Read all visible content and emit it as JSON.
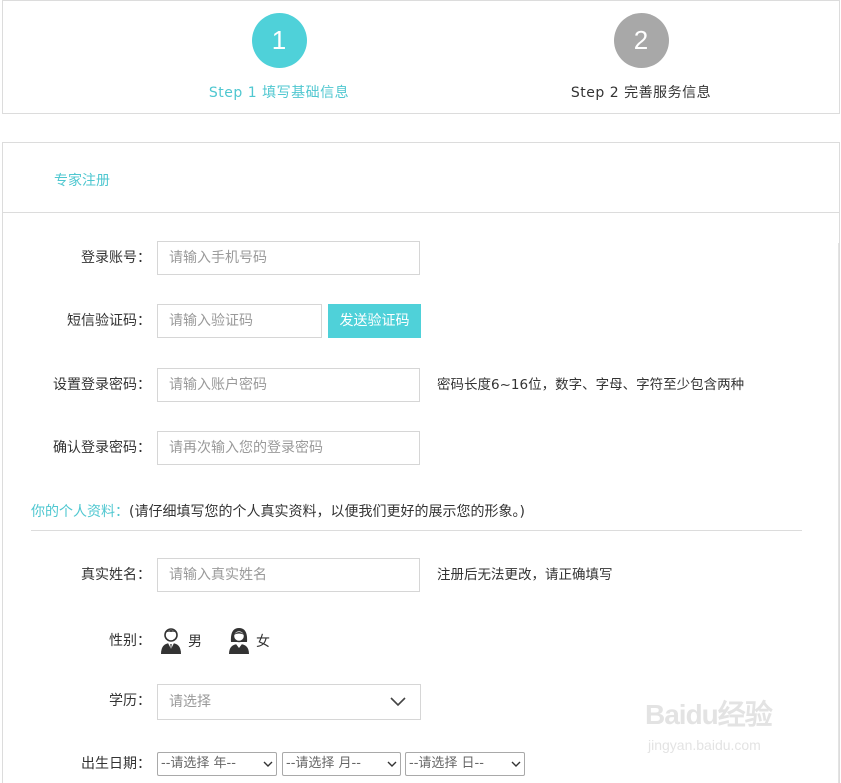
{
  "steps": [
    {
      "number": "1",
      "label": "Step 1 填写基础信息",
      "state": "active"
    },
    {
      "number": "2",
      "label": "Step 2 完善服务信息",
      "state": "inactive"
    }
  ],
  "panel": {
    "title": "专家注册"
  },
  "fields": {
    "account": {
      "label": "登录账号：",
      "placeholder": "请输入手机号码"
    },
    "sms_code": {
      "label": "短信验证码：",
      "placeholder": "请输入验证码",
      "button": "发送验证码"
    },
    "password": {
      "label": "设置登录密码：",
      "placeholder": "请输入账户密码",
      "hint": "密码长度6~16位，数字、字母、字符至少包含两种"
    },
    "confirm_password": {
      "label": "确认登录密码：",
      "placeholder": "请再次输入您的登录密码"
    },
    "real_name": {
      "label": "真实姓名：",
      "placeholder": "请输入真实姓名",
      "hint": "注册后无法更改，请正确填写"
    },
    "gender": {
      "label": "性别：",
      "options": [
        "男",
        "女"
      ]
    },
    "education": {
      "label": "学历：",
      "value": "请选择"
    },
    "birthdate": {
      "label": "出生日期：",
      "year": "--请选择 年--",
      "month": "--请选择 月--",
      "day": "--请选择 日--"
    }
  },
  "section": {
    "highlight": "你的个人资料：",
    "text": "(请仔细填写您的个人真实资料，以便我们更好的展示您的形象。)"
  },
  "watermark": {
    "logo": "Baidu经验",
    "url": "jingyan.baidu.com"
  },
  "colors": {
    "accent": "#4fd1d9",
    "inactive_step": "#a8a8a8",
    "border": "#dcdcdc"
  }
}
